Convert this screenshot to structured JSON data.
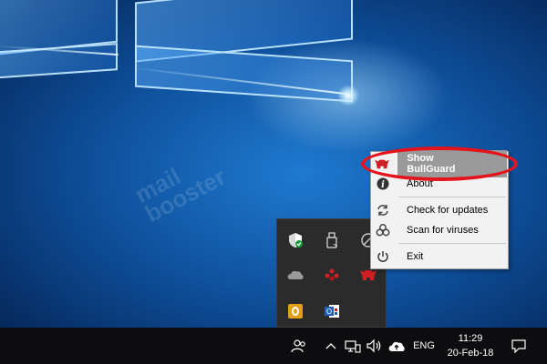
{
  "desktop": {
    "watermark": "mail\nbooster"
  },
  "context_menu": {
    "items": [
      {
        "label": "Show BullGuard",
        "icon": "bullguard-bull-icon",
        "highlighted": true
      },
      {
        "label": "About",
        "icon": "info-icon"
      },
      {
        "label": "Check for updates",
        "icon": "refresh-icon"
      },
      {
        "label": "Scan for viruses",
        "icon": "biohazard-icon"
      },
      {
        "label": "Exit",
        "icon": "power-icon"
      }
    ]
  },
  "tray_overflow": {
    "icons": [
      "windows-defender-icon",
      "usb-device-icon",
      "network-antivirus-icon",
      "onedrive-icon",
      "cluster-icon",
      "bullguard-bull-icon",
      "outlook-icon",
      "outlook-calendar-icon"
    ]
  },
  "taskbar": {
    "language": "ENG",
    "time": "11:29",
    "date": "20-Feb-18",
    "icons": [
      "people-icon",
      "chevron-up-icon",
      "network-icon",
      "volume-icon",
      "cloud-icon",
      "action-center-icon"
    ]
  },
  "colors": {
    "highlight_ellipse": "#e3141b",
    "bullguard_red": "#d01f25",
    "menu_highlight": "#9a9a9a",
    "taskbar_bg": "#0d0d0f"
  }
}
